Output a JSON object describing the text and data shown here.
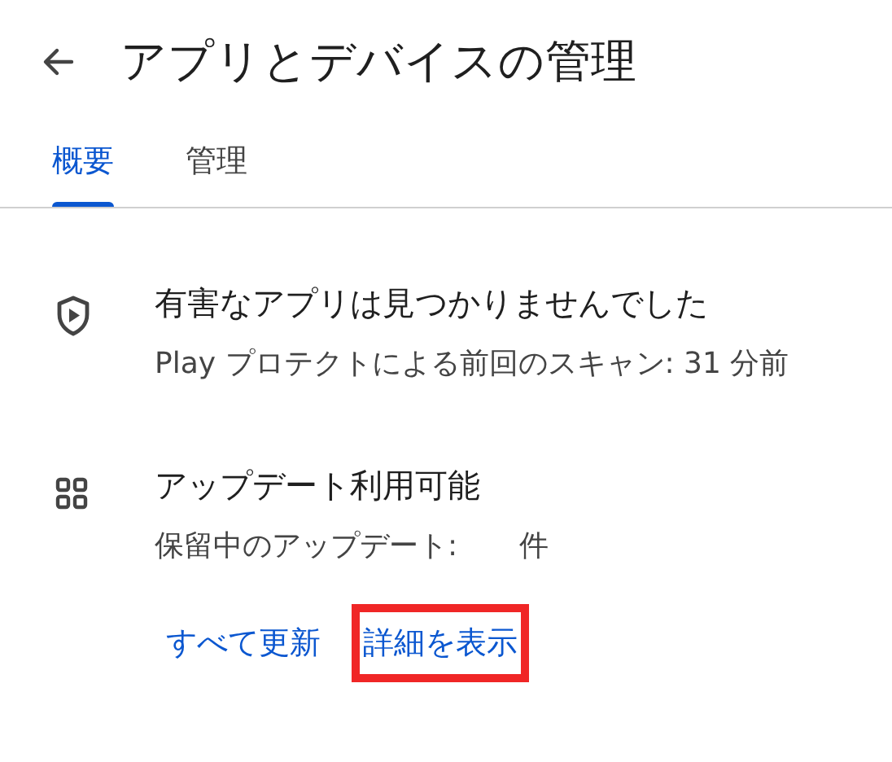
{
  "header": {
    "title": "アプリとデバイスの管理"
  },
  "tabs": [
    {
      "label": "概要",
      "selected": true
    },
    {
      "label": "管理",
      "selected": false
    }
  ],
  "sections": [
    {
      "kind": "protect",
      "title": "有害なアプリは見つかりませんでした",
      "lines": [
        "Play プロテクトによる前回のスキャン: 31 分前"
      ]
    },
    {
      "kind": "updates",
      "title": "アップデート利用可能",
      "lines": [
        "保留中のアップデート:",
        "件"
      ],
      "links": [
        {
          "label": "すべて更新",
          "highlighted": false
        },
        {
          "label": "詳細を表示",
          "highlighted": true
        }
      ]
    }
  ]
}
